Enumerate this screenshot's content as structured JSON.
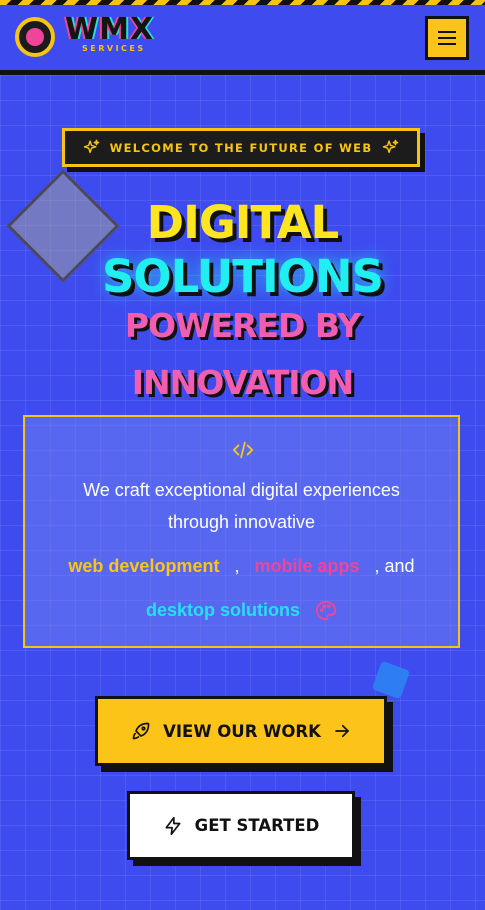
{
  "header": {
    "logo_text": "WMX",
    "logo_subtext": "SERVICES",
    "menu_icon": "hamburger-icon"
  },
  "banner": {
    "text": "WELCOME TO THE FUTURE OF WEB",
    "icon": "sparkle-icon"
  },
  "hero": {
    "line1": "DIGITAL",
    "line2": "SOLUTIONS",
    "line3": "POWERED BY",
    "line4": "INNOVATION"
  },
  "card": {
    "icon": "code-icon",
    "text_line1": "We craft exceptional digital experiences",
    "text_line2": "through innovative",
    "highlight1": "web development",
    "sep1": ",",
    "highlight2": "mobile apps",
    "sep2": ", and",
    "highlight3": "desktop solutions",
    "end_icon": "palette-icon"
  },
  "buttons": {
    "work_label": "VIEW OUR WORK",
    "start_label": "GET STARTED"
  },
  "colors": {
    "background": "#3e4bef",
    "yellow": "#fcc419",
    "pink": "#f0449a",
    "cyan": "#21eef0"
  }
}
